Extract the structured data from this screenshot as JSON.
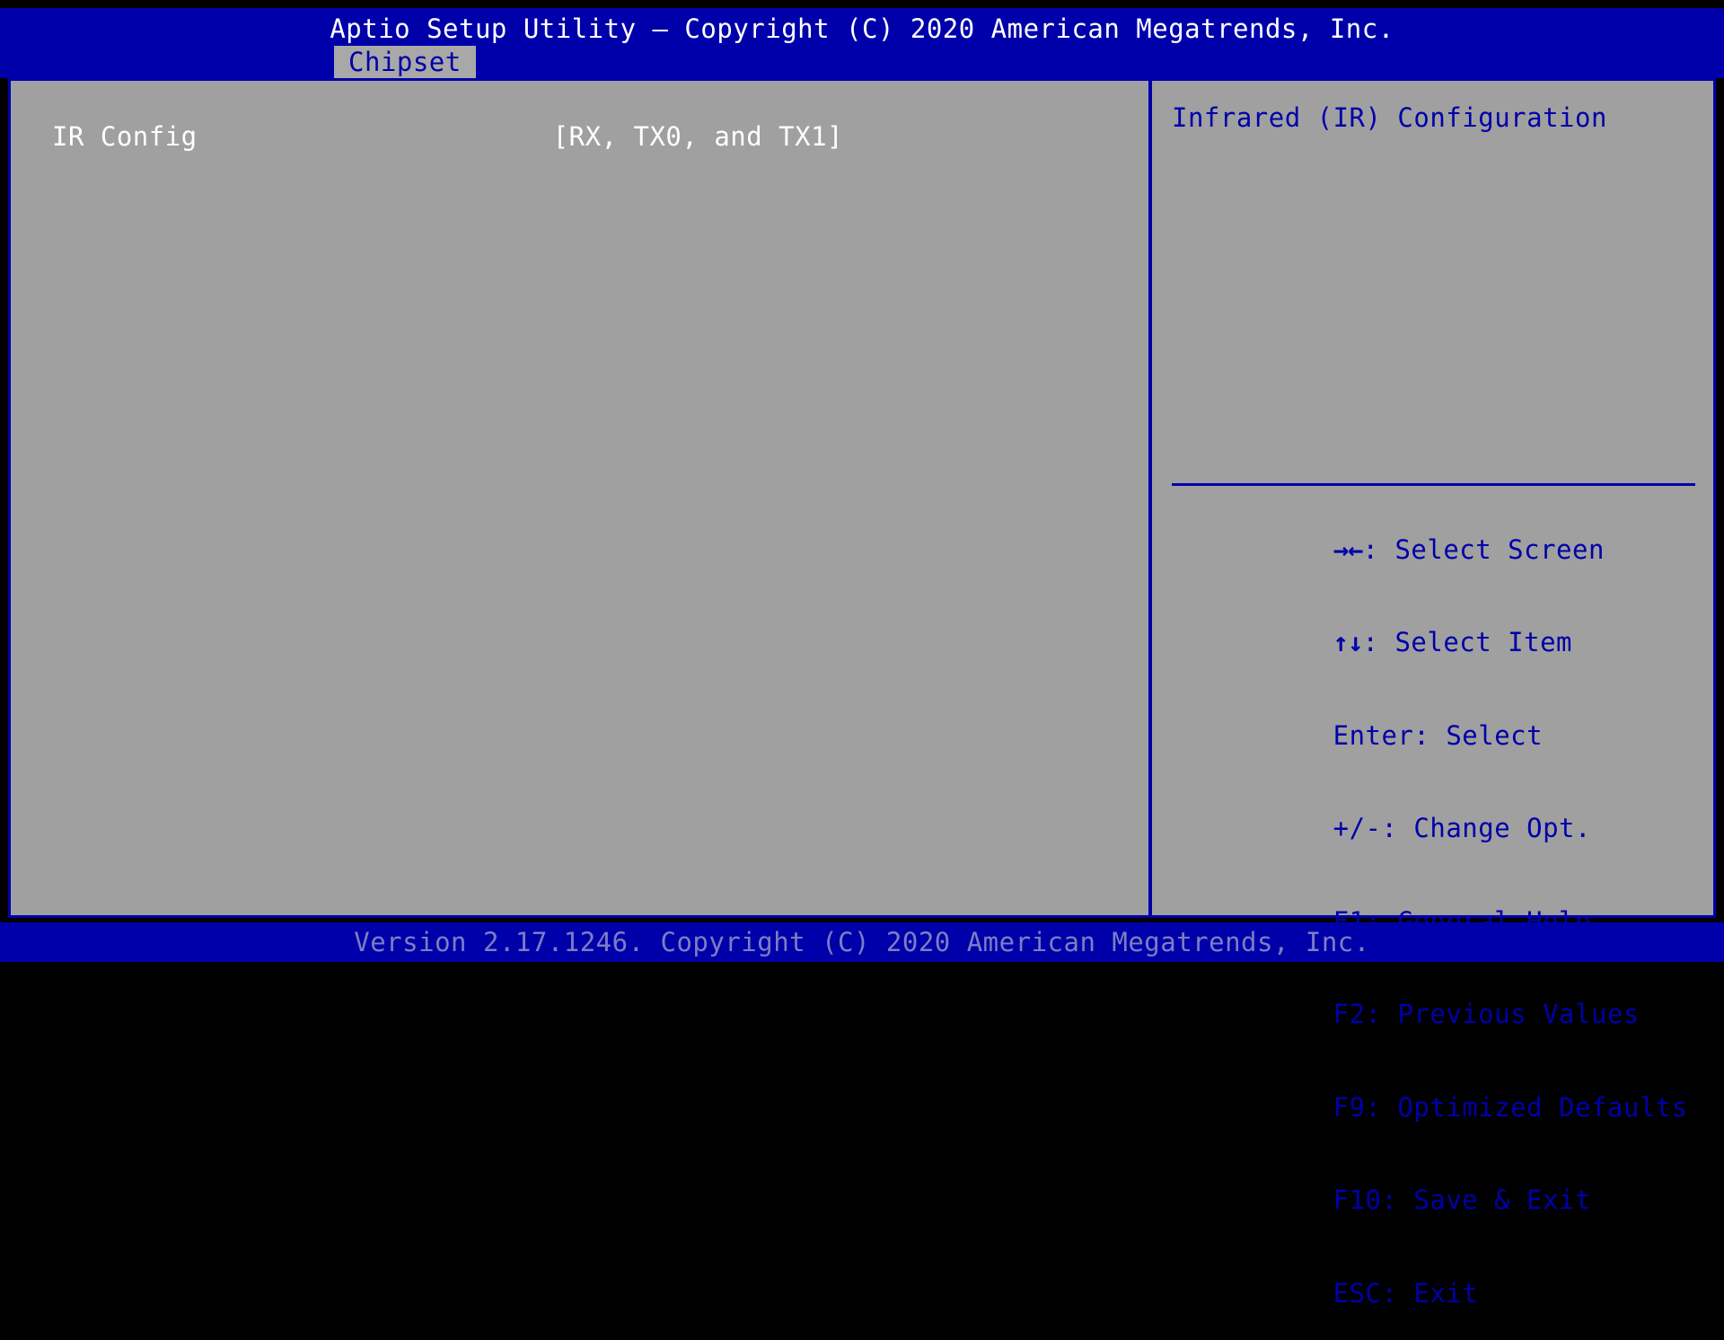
{
  "title_bar": {
    "title": "Aptio Setup Utility – Copyright (C) 2020 American Megatrends, Inc."
  },
  "tabs": [
    {
      "label": "Chipset",
      "active": true
    }
  ],
  "settings": [
    {
      "label": "IR Config",
      "value": "[RX, TX0, and TX1]"
    }
  ],
  "help_panel": {
    "description": "Infrared (IR) Configuration",
    "key_legend": [
      {
        "key": "→←",
        "glyph_name": "right-left-arrow-icon",
        "separator": ": ",
        "action": "Select Screen"
      },
      {
        "key": "↑↓",
        "glyph_name": "up-down-arrow-icon",
        "separator": ": ",
        "action": "Select Item"
      },
      {
        "key": "Enter",
        "glyph_name": "enter-key",
        "separator": ": ",
        "action": "Select"
      },
      {
        "key": "+/-",
        "glyph_name": "plus-minus-key",
        "separator": ": ",
        "action": "Change Opt."
      },
      {
        "key": "F1",
        "glyph_name": "f1-key",
        "separator": ": ",
        "action": "General Help"
      },
      {
        "key": "F2",
        "glyph_name": "f2-key",
        "separator": ": ",
        "action": "Previous Values"
      },
      {
        "key": "F9",
        "glyph_name": "f9-key",
        "separator": ": ",
        "action": "Optimized Defaults"
      },
      {
        "key": "F10",
        "glyph_name": "f10-key",
        "separator": ": ",
        "action": "Save & Exit"
      },
      {
        "key": "ESC",
        "glyph_name": "esc-key",
        "separator": ": ",
        "action": "Exit"
      }
    ]
  },
  "version_bar": {
    "text": "Version 2.17.1246. Copyright (C) 2020 American Megatrends, Inc."
  },
  "colors": {
    "background": "#000000",
    "bar_blue": "#0000aa",
    "panel_gray": "#a0a0a0",
    "tab_gray": "#a8a8a8",
    "white_text": "#ffffff",
    "blue_text": "#0000aa",
    "version_text": "#7d7dc4"
  }
}
